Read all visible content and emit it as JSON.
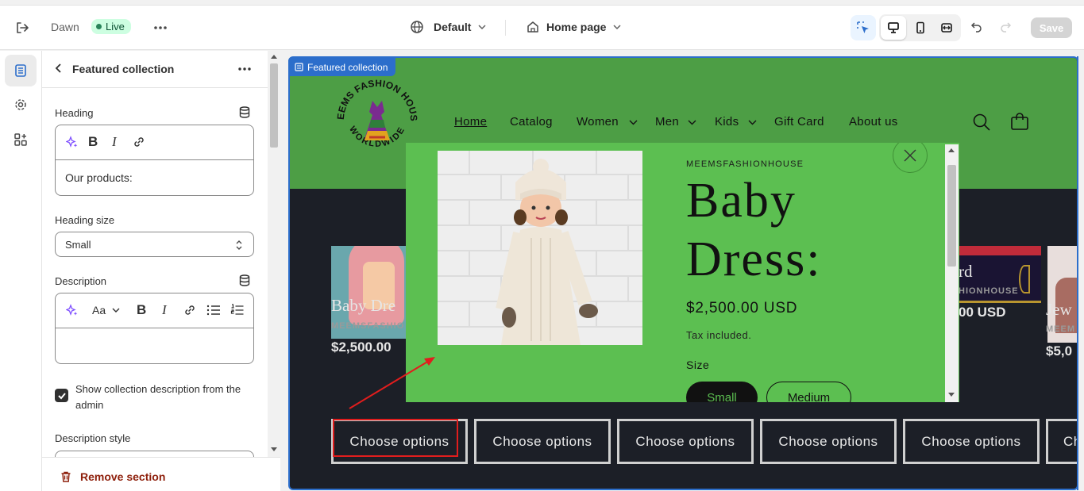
{
  "topbar": {
    "theme_name": "Dawn",
    "status_badge": "Live",
    "template_select": "Default",
    "page_select": "Home page",
    "save_label": "Save"
  },
  "panel": {
    "title": "Featured collection",
    "heading_label": "Heading",
    "heading_value": "Our products:",
    "heading_size_label": "Heading size",
    "heading_size_value": "Small",
    "description_label": "Description",
    "description_value": "",
    "font_size_button": "Aa",
    "checkbox_label": "Show collection description from the admin",
    "checkbox_checked": true,
    "description_style_label": "Description style",
    "remove_section_label": "Remove section"
  },
  "preview": {
    "section_tag": "Featured collection",
    "logo_top_text": "MEEMS FASHION HOUSE",
    "logo_bottom_text": "WORLDWIDE",
    "nav": [
      "Home",
      "Catalog",
      "Women",
      "Men",
      "Kids",
      "Gift Card",
      "About us"
    ],
    "cards": [
      {
        "title": "Baby Dre",
        "vendor": "MEEMSFASHIO",
        "price": "$2,500.00"
      },
      {
        "title": "rd",
        "vendor": "HIONHOUSE",
        "price": "00 USD"
      },
      {
        "title": "Jew",
        "vendor": "MEEM",
        "price": "$5,0"
      }
    ],
    "choose_labels": [
      "Choose options",
      "Choose options",
      "Choose options",
      "Choose options",
      "Choose options",
      "Ch"
    ]
  },
  "modal": {
    "vendor": "MEEMSFASHIONHOUSE",
    "title_line1": "Baby",
    "title_line2": "Dress:",
    "price": "$2,500.00 USD",
    "tax_note": "Tax included.",
    "size_label": "Size",
    "sizes": [
      "Small",
      "Medium"
    ]
  },
  "colors": {
    "header_green": "#4d9e45",
    "modal_green": "#5cbf51",
    "annotation_red": "#e11d1d",
    "editor_blue": "#2c6ecb"
  }
}
